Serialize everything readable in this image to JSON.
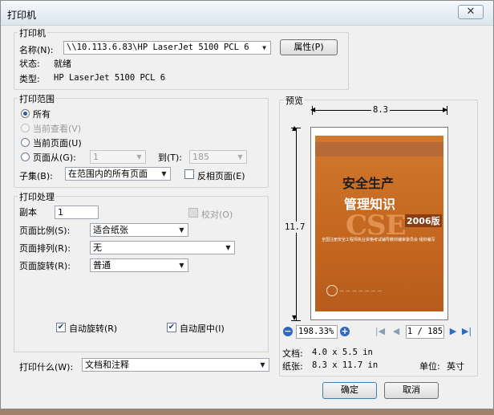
{
  "window": {
    "title": "打印机",
    "close_glyph": "✕"
  },
  "printer": {
    "group_label": "打印机",
    "name_label": "名称(N):",
    "name_value": "\\\\10.113.6.83\\HP LaserJet 5100 PCL 6",
    "properties_button": "属性(P)",
    "status_label": "状态:",
    "status_value": "就绪",
    "type_label": "类型:",
    "type_value": "HP LaserJet 5100 PCL 6"
  },
  "range": {
    "group_label": "打印范围",
    "all": "所有",
    "current_view": "当前查看(V)",
    "current_page": "当前页面(U)",
    "pages_from": "页面从(G):",
    "from_value": "1",
    "to_label": "到(T):",
    "to_value": "185",
    "subset_label": "子集(B):",
    "subset_value": "在范围内的所有页面",
    "reverse_label": "反相页面(E)"
  },
  "handling": {
    "group_label": "打印处理",
    "copies_label": "副本",
    "copies_value": "1",
    "collate_label": "校对(O)",
    "scale_label": "页面比例(S):",
    "scale_value": "适合纸张",
    "arrange_label": "页面排列(R):",
    "arrange_value": "无",
    "rotate_label": "页面旋转(R):",
    "rotate_value": "普通",
    "auto_rotate": "自动旋转(R)",
    "auto_center": "自动居中(I)"
  },
  "what": {
    "label": "打印什么(W):",
    "value": "文档和注释"
  },
  "preview": {
    "group_label": "预览",
    "width_dim": "8.3",
    "height_dim": "11.7",
    "zoom_value": "198.33%",
    "page_value": "1 / 185",
    "document_label": "文档:",
    "document_value": "4.0 x 5.5 in",
    "paper_label": "纸张:",
    "paper_value": "8.3 x 11.7 in",
    "unit_label": "单位:",
    "unit_value": "英寸",
    "cover": {
      "title_line1": "安全生产",
      "title_line2": "管理知识",
      "big_text": "CSE",
      "edition": "2006版",
      "subtitle": "全国注册安全工程师执业资格考试辅导教材编审委员会  组织编写"
    }
  },
  "buttons": {
    "ok": "确定",
    "cancel": "取消"
  },
  "colors": {
    "accent": "#2c5aa8",
    "cover_orange": "#c66a22"
  }
}
